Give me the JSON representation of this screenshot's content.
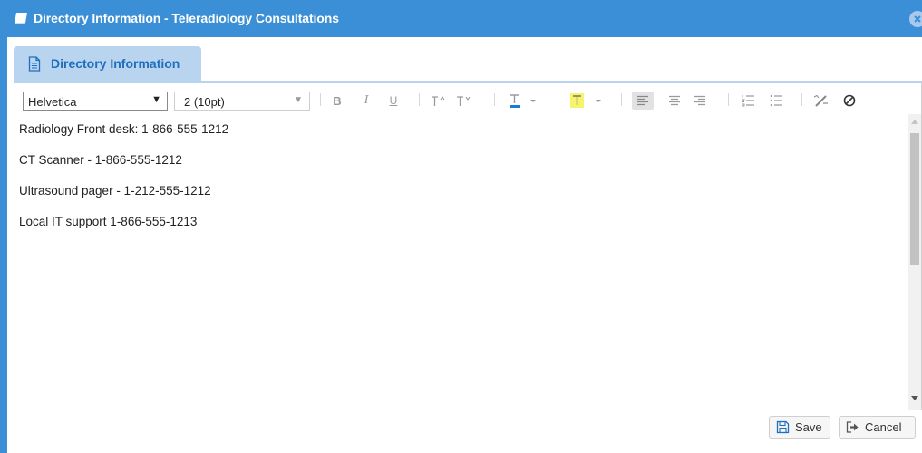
{
  "window": {
    "title": "Directory Information - Teleradiology Consultations"
  },
  "tabs": [
    {
      "label": "Directory Information"
    }
  ],
  "toolbar": {
    "font_family": "Helvetica",
    "font_size": "2 (10pt)",
    "icons": [
      "bold-icon",
      "italic-icon",
      "underline-icon",
      "superscript-icon",
      "subscript-icon",
      "text-color-icon",
      "highlight-icon",
      "align-left-icon",
      "align-center-icon",
      "align-right-icon",
      "ordered-list-icon",
      "unordered-list-icon",
      "clear-format-icon",
      "block-icon"
    ],
    "text_color_swatch": "#1d7ad8",
    "highlight_swatch": "#f7f36a"
  },
  "content": {
    "lines": [
      "Radiology Front desk: 1-866-555-1212",
      "CT Scanner - 1-866-555-1212",
      "Ultrasound pager - 1-212-555-1212",
      "Local IT support 1-866-555-1213"
    ]
  },
  "footer": {
    "save_label": "Save",
    "cancel_label": "Cancel"
  },
  "colors": {
    "titlebar": "#3a8fd6",
    "tab": "#b9d4ee",
    "tab_text": "#1d6fbf"
  }
}
